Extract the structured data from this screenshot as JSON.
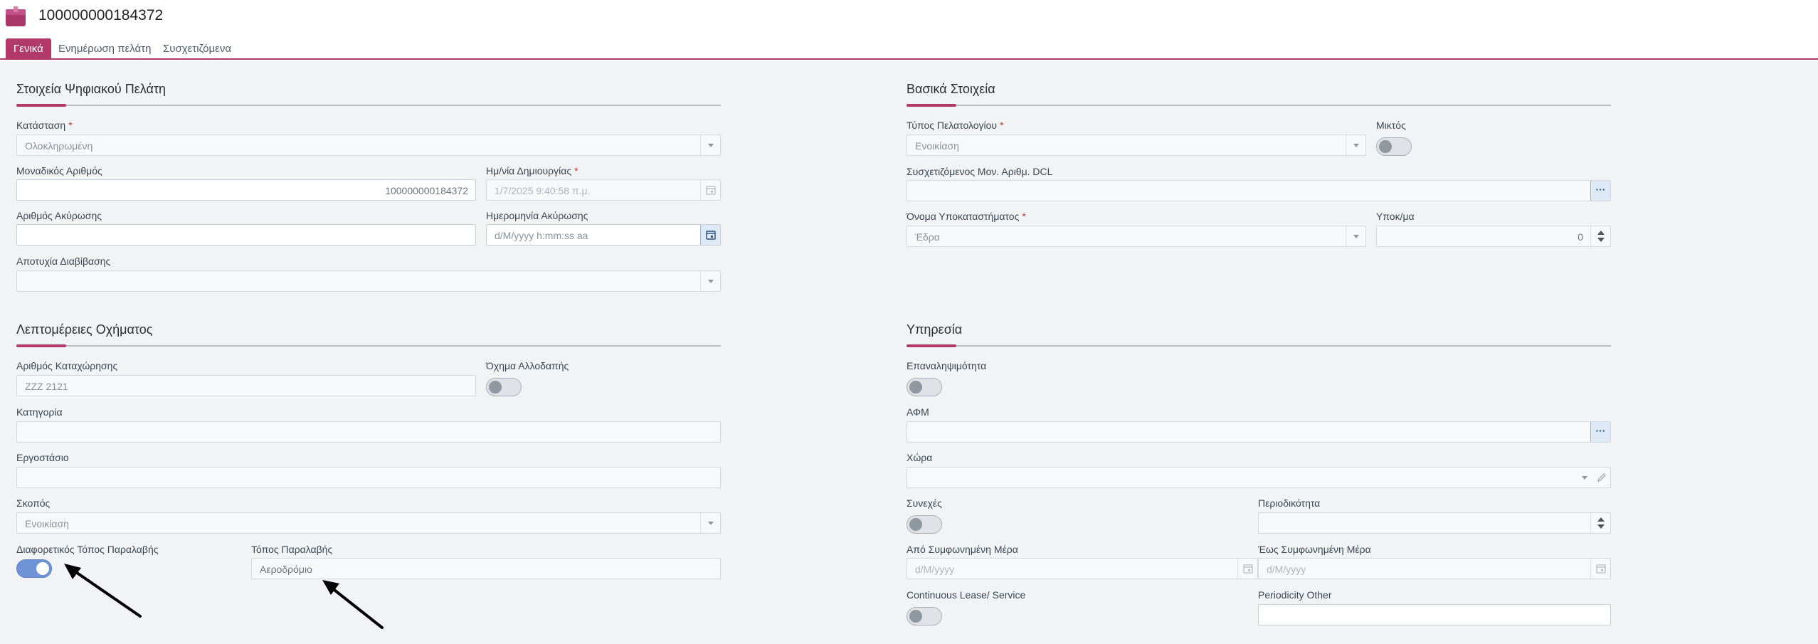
{
  "header": {
    "record_id": "100000000184372",
    "icon": "app-record-icon"
  },
  "tabs": [
    {
      "label": "Γενικά",
      "active": true
    },
    {
      "label": "Ενημέρωση πελάτη",
      "active": false
    },
    {
      "label": "Συσχετιζόμενα",
      "active": false
    }
  ],
  "digital_customer": {
    "title": "Στοιχεία Ψηφιακού Πελάτη",
    "status_label": "Κατάσταση",
    "status_value": "Ολοκληρωμένη",
    "unique_number_label": "Μοναδικός Αριθμός",
    "unique_number_value": "100000000184372",
    "creation_date_label": "Ημ/νία Δημιουργίας",
    "creation_date_value": "1/7/2025 9:40:58 π.μ.",
    "cancel_number_label": "Αριθμός Ακύρωσης",
    "cancel_number_value": "",
    "cancel_date_label": "Ημερομηνία Ακύρωσης",
    "cancel_date_placeholder": "d/M/yyyy h:mm:ss aa",
    "transmission_failure_label": "Αποτυχία Διαβίβασης",
    "transmission_failure_value": ""
  },
  "basic": {
    "title": "Βασικά Στοιχεία",
    "register_type_label": "Τύπος Πελατολογίου",
    "register_type_value": "Ενοικίαση",
    "mixed_label": "Μικτός",
    "mixed_on": false,
    "dcl_label": "Συσχετιζόμενος Μον. Αριθμ. DCL",
    "dcl_value": "",
    "dcl_lookup_symbol": "···",
    "branch_label": "Όνομα Υποκαταστήματος",
    "branch_value": "Έδρα",
    "sub_label": "Υποκ/μα",
    "sub_value": "0"
  },
  "vehicle": {
    "title": "Λεπτομέρειες Οχήματος",
    "plate_label": "Αριθμός Καταχώρησης",
    "plate_value": "ZZZ 2121",
    "foreign_label": "Όχημα Αλλοδαπής",
    "foreign_on": false,
    "category_label": "Κατηγορία",
    "category_value": "",
    "factory_label": "Εργοστάσιο",
    "factory_value": "",
    "purpose_label": "Σκοπός",
    "purpose_value": "Ενοικίαση",
    "diff_pickup_label": "Διαφορετικός Τόπος Παραλαβής",
    "diff_pickup_on": true,
    "pickup_place_label": "Τόπος Παραλαβής",
    "pickup_place_value": "Αεροδρόμιο"
  },
  "service": {
    "title": "Υπηρεσία",
    "recurrence_label": "Επαναληψιμότητα",
    "recurrence_on": false,
    "afm_label": "ΑΦΜ",
    "afm_value": "",
    "afm_lookup_symbol": "···",
    "country_label": "Χώρα",
    "country_value": "",
    "continuous_label": "Συνεχές",
    "continuous_on": false,
    "periodicity_label": "Περιοδικότητα",
    "periodicity_value": "",
    "from_day_label": "Από Συμφωνημένη Μέρα",
    "from_day_placeholder": "d/M/yyyy",
    "to_day_label": "Έως Συμφωνημένη Μέρα",
    "to_day_placeholder": "d/M/yyyy",
    "cont_lease_label": "Continuous Lease/ Service",
    "cont_lease_on": false,
    "periodicity_other_label": "Periodicity Other",
    "periodicity_other_value": ""
  },
  "colors": {
    "accent": "#b13a6b",
    "toggle_on": "#6e93d6",
    "content_bg": "#f1f3f5"
  }
}
